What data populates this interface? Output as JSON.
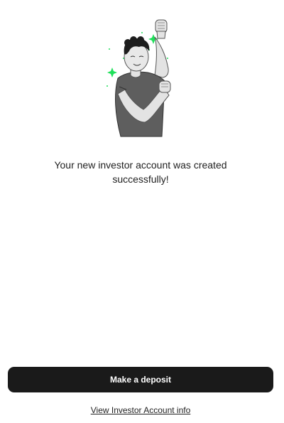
{
  "success": {
    "message": "Your new investor account was created successfully!"
  },
  "actions": {
    "primary_label": "Make a deposit",
    "secondary_link": "View Investor Account info"
  },
  "colors": {
    "button_bg": "#1a1a1a",
    "sparkle": "#1fe05a",
    "text": "#1f1f1f"
  },
  "illustration": {
    "icon": "celebrating-person-illustration"
  }
}
